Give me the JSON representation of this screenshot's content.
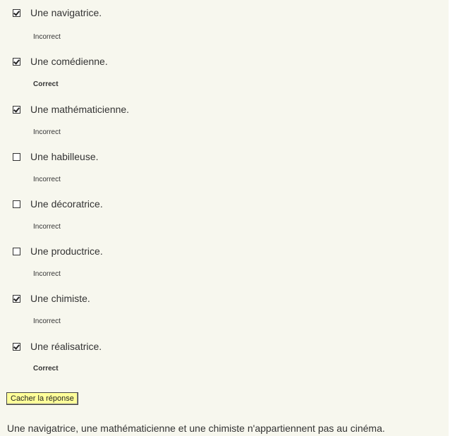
{
  "quiz": {
    "options": [
      {
        "label": "Une navigatrice.",
        "checked": true,
        "feedback": "Incorrect",
        "correct": false
      },
      {
        "label": "Une comédienne.",
        "checked": true,
        "feedback": "Correct",
        "correct": true
      },
      {
        "label": "Une mathématicienne.",
        "checked": true,
        "feedback": "Incorrect",
        "correct": false
      },
      {
        "label": "Une habilleuse.",
        "checked": false,
        "feedback": "Incorrect",
        "correct": false
      },
      {
        "label": "Une décoratrice.",
        "checked": false,
        "feedback": "Incorrect",
        "correct": false
      },
      {
        "label": "Une productrice.",
        "checked": false,
        "feedback": "Incorrect",
        "correct": false
      },
      {
        "label": "Une chimiste.",
        "checked": true,
        "feedback": "Incorrect",
        "correct": false
      },
      {
        "label": "Une réalisatrice.",
        "checked": true,
        "feedback": "Correct",
        "correct": true
      }
    ],
    "hide_button_label": "Cacher la réponse",
    "explanation": "Une navigatrice, une mathématicienne et une chimiste n'appartiennent pas au cinéma."
  },
  "colors": {
    "panel_background": "#f7f7ee",
    "button_background": "#ffff9a",
    "text": "#333333"
  }
}
